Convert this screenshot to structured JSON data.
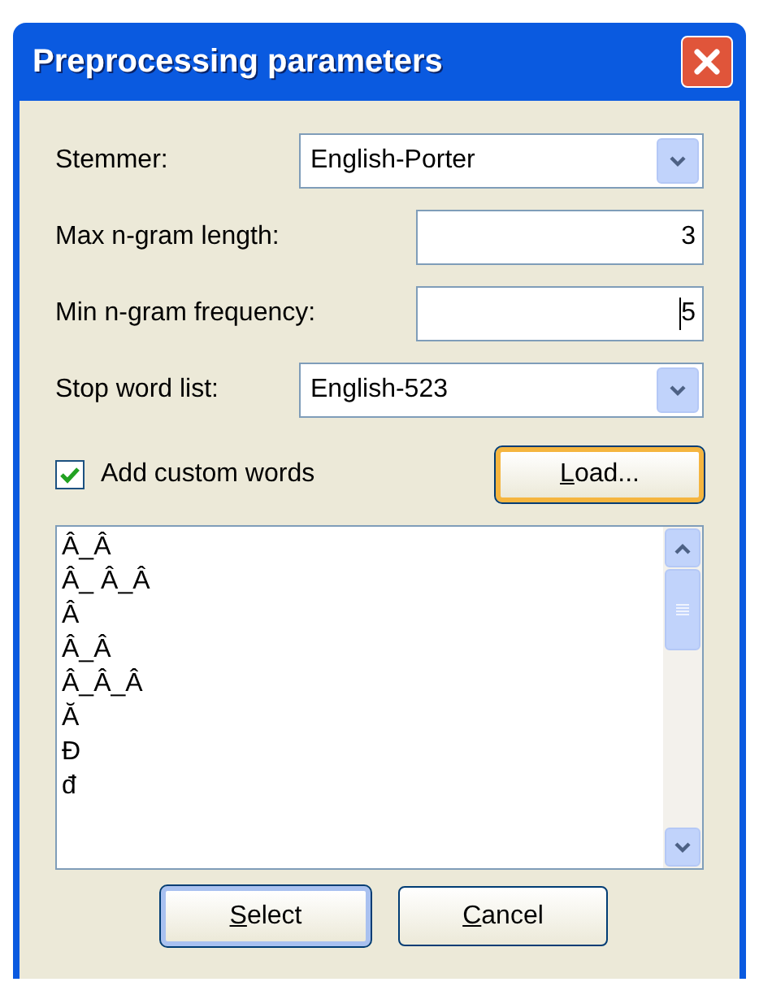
{
  "window": {
    "title": "Preprocessing parameters"
  },
  "fields": [
    {
      "kind": "combo",
      "label": "Stemmer:",
      "value": "English-Porter"
    },
    {
      "kind": "text",
      "label": "Max n-gram length:",
      "value": "3",
      "focused": false
    },
    {
      "kind": "text",
      "label": "Min n-gram frequency:",
      "value": "5",
      "focused": true
    },
    {
      "kind": "combo",
      "label": "Stop word list:",
      "value": "English-523"
    }
  ],
  "custom_words": {
    "label": "Add custom words",
    "checked": true
  },
  "load_button": {
    "accelerator": "L",
    "label_rest": "oad...",
    "hot": true
  },
  "word_list": [
    "Â_Â",
    "Â_ Â_Â",
    "Â",
    "Â_Â",
    "Â_Â_Â",
    "Ă",
    "Đ",
    "đ"
  ],
  "buttons": [
    {
      "accelerator": "S",
      "label_rest": "elect",
      "default": true
    },
    {
      "accelerator": "C",
      "label_rest": "ancel",
      "default": false
    }
  ]
}
